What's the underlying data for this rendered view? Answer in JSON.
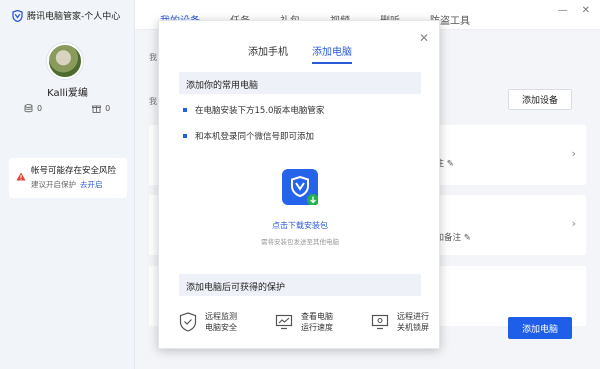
{
  "app": {
    "title": "腾讯电脑管家-个人中心"
  },
  "profile": {
    "username": "Kalli爱编",
    "storage_count": "0",
    "gift_count": "0"
  },
  "alert": {
    "title": "帐号可能存在安全风险",
    "subtitle": "建议开启保护",
    "link": "去开启"
  },
  "tabs": [
    {
      "label": "我的设备",
      "active": true
    },
    {
      "label": "任务"
    },
    {
      "label": "礼包"
    },
    {
      "label": "视频"
    },
    {
      "label": "删听"
    },
    {
      "label": "防盗工具"
    }
  ],
  "main": {
    "hint1": "我",
    "hint2": "我",
    "add_device_label": "添加设备",
    "card1_note": "备注",
    "card2_note": "添加备注",
    "add_pc_label": "添加电脑"
  },
  "dialog": {
    "tabs": [
      {
        "label": "添加手机",
        "active": false
      },
      {
        "label": "添加电脑",
        "active": true
      }
    ],
    "section1_title": "添加你的常用电脑",
    "bullet1": "在电脑安装下方15.0版本电脑管家",
    "bullet2": "和本机登录同个微信号即可添加",
    "download_link": "点击下载安装包",
    "download_note": "需将安装包发送至其他电脑",
    "section2_title": "添加电脑后可获得的保护",
    "features": [
      {
        "icon": "shield-icon",
        "line1": "远程监测",
        "line2": "电脑安全"
      },
      {
        "icon": "speed-chart-icon",
        "line1": "查看电脑",
        "line2": "运行速度"
      },
      {
        "icon": "screen-lock-icon",
        "line1": "远程进行",
        "line2": "关机锁屏"
      }
    ]
  },
  "colors": {
    "accent": "#1f5ee8",
    "sidebar_bg": "#f1f4f8",
    "alert": "#e0433d"
  }
}
